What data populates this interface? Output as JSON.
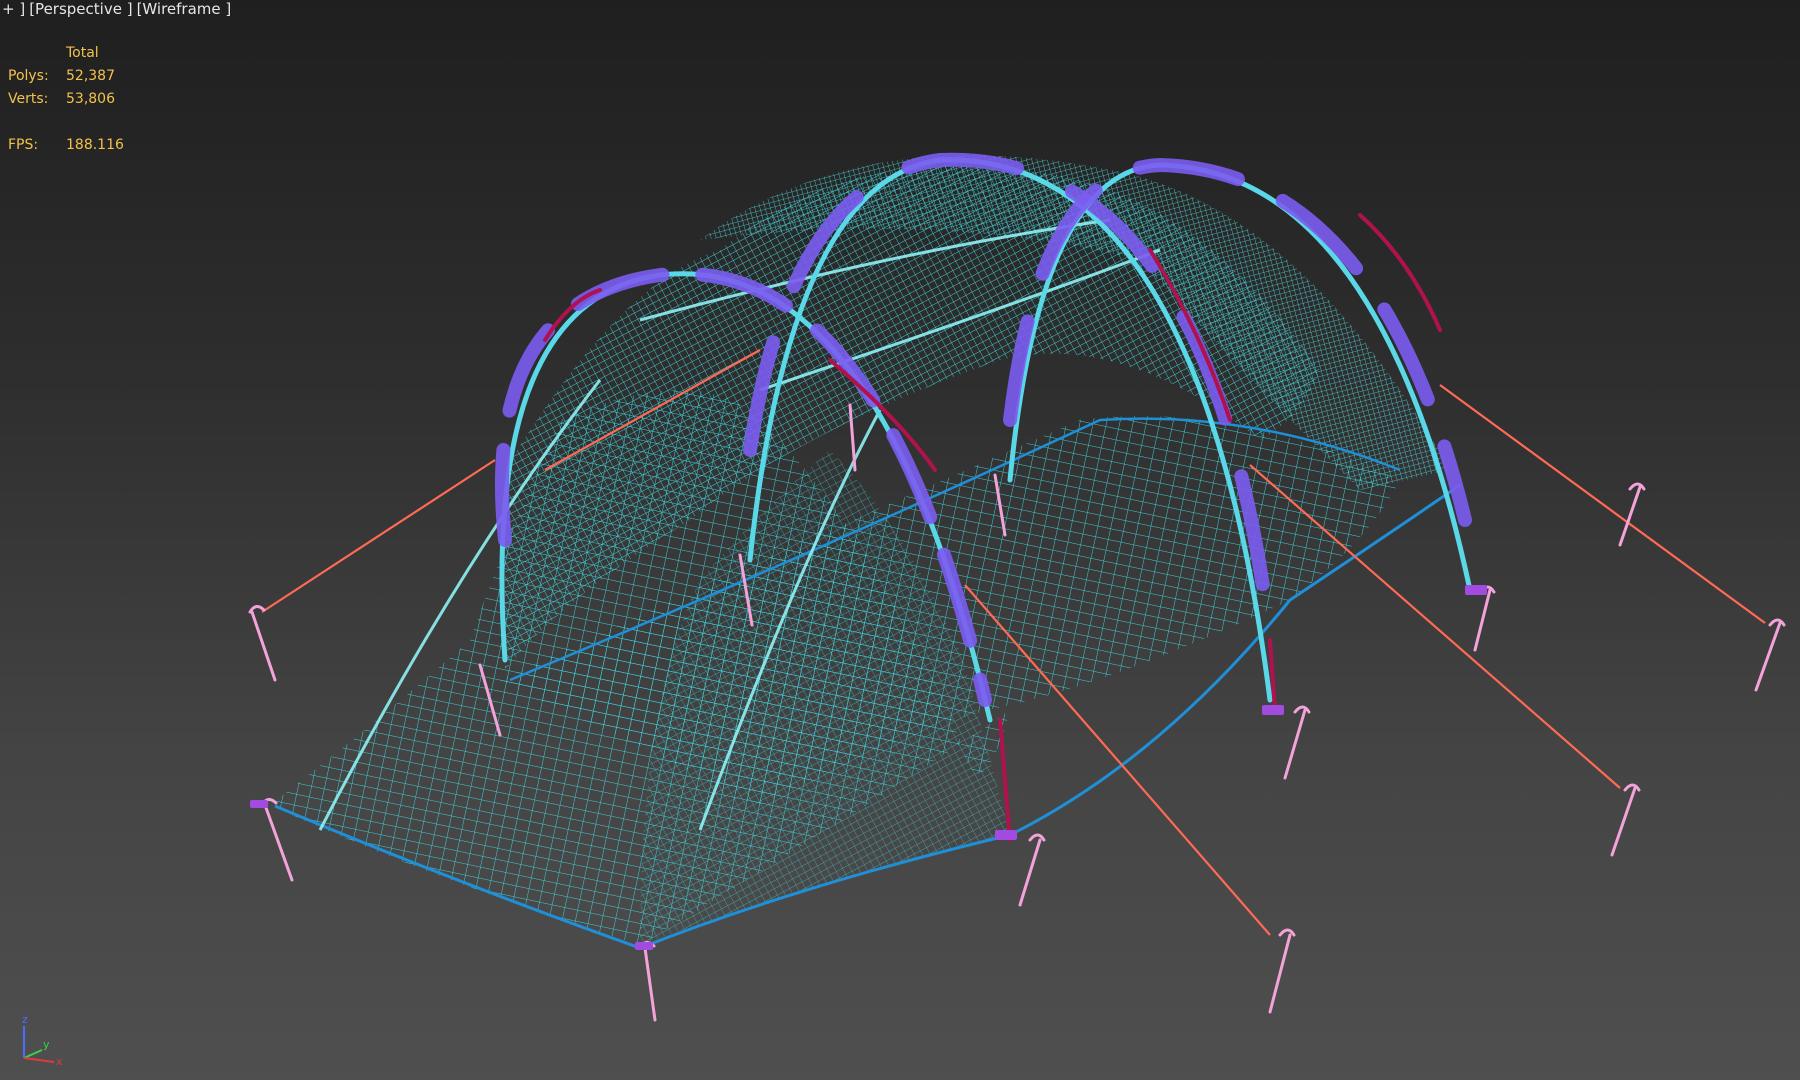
{
  "viewport": {
    "plus_label": "+ ]",
    "view_label": "[Perspective ]",
    "shading_label": "[Wireframe ]"
  },
  "stats": {
    "header": "Total",
    "polys_label": "Polys:",
    "polys_value": "52,387",
    "verts_label": "Verts:",
    "verts_value": "53,806",
    "fps_label": "FPS:",
    "fps_value": "188.116"
  },
  "gizmo": {
    "z_label": "z",
    "y_label": "y",
    "x_label": "x"
  },
  "colors": {
    "mesh": "#3fd6df",
    "mesh_dark": "#1f8fd8",
    "pole": "#7b5cf0",
    "pole_red": "#b0124e",
    "guyline": "#ff6a55",
    "peg": "#f3a3d9",
    "stats_text": "#f2c24b",
    "label_text": "#e6e6e6"
  },
  "scene": {
    "object": "tent-wireframe-model",
    "icons": [
      "axis-gizmo-icon"
    ]
  }
}
